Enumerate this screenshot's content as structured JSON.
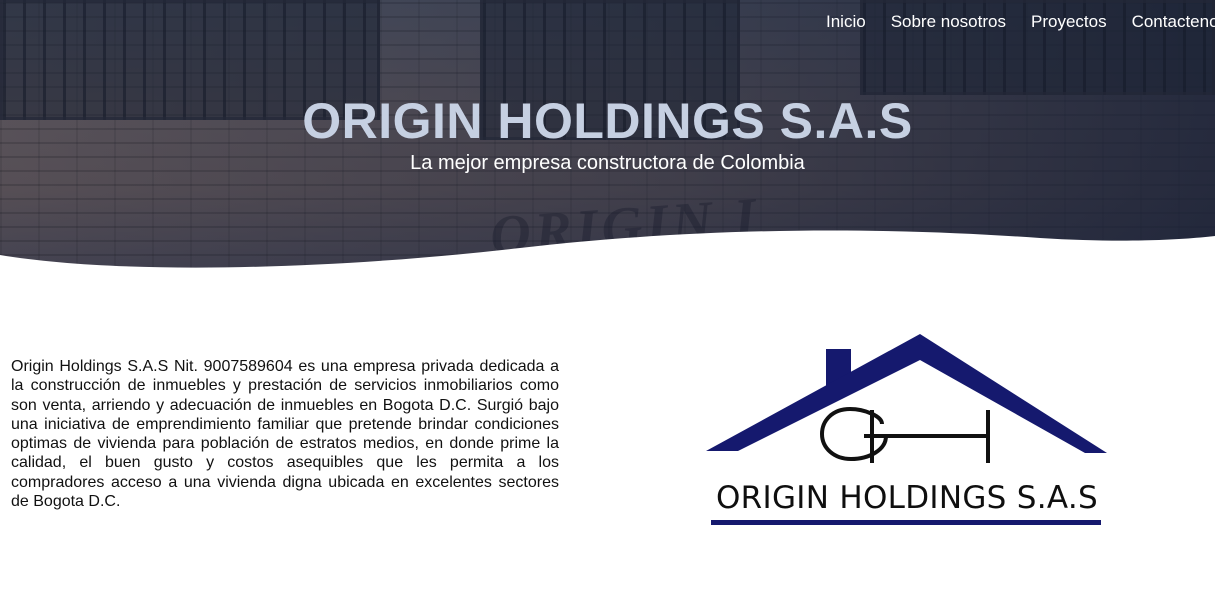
{
  "nav": {
    "items": [
      "Inicio",
      "Sobre nosotros",
      "Proyectos",
      "Contactenos"
    ]
  },
  "hero": {
    "title": "ORIGIN HOLDINGS S.A.S",
    "subtitle": "La mejor empresa constructora de Colombia",
    "sign_text": "ORIGIN I"
  },
  "about": {
    "text": "Origin Holdings S.A.S Nit. 9007589604 es una empresa privada dedicada a la construcción de inmuebles y prestación de servicios inmobiliarios como son venta, arriendo y adecuación de inmuebles en Bogota D.C. Surgió bajo una iniciativa de emprendimiento familiar que pretende brindar condiciones optimas de vivienda para población de estratos medios, en donde prime la calidad, el buen gusto y costos asequibles que les permita a los compradores acceso a una vivienda digna ubicada en excelentes sectores de Bogota D.C."
  },
  "logo": {
    "name": "ORIGIN HOLDINGS S.A.S",
    "roof_color": "#15196e",
    "monogram_color": "#111111"
  },
  "colors": {
    "hero_title": "#c6d0e2",
    "hero_overlay": "#1f2840",
    "nav_text": "#ffffff",
    "body_text": "#111111"
  }
}
